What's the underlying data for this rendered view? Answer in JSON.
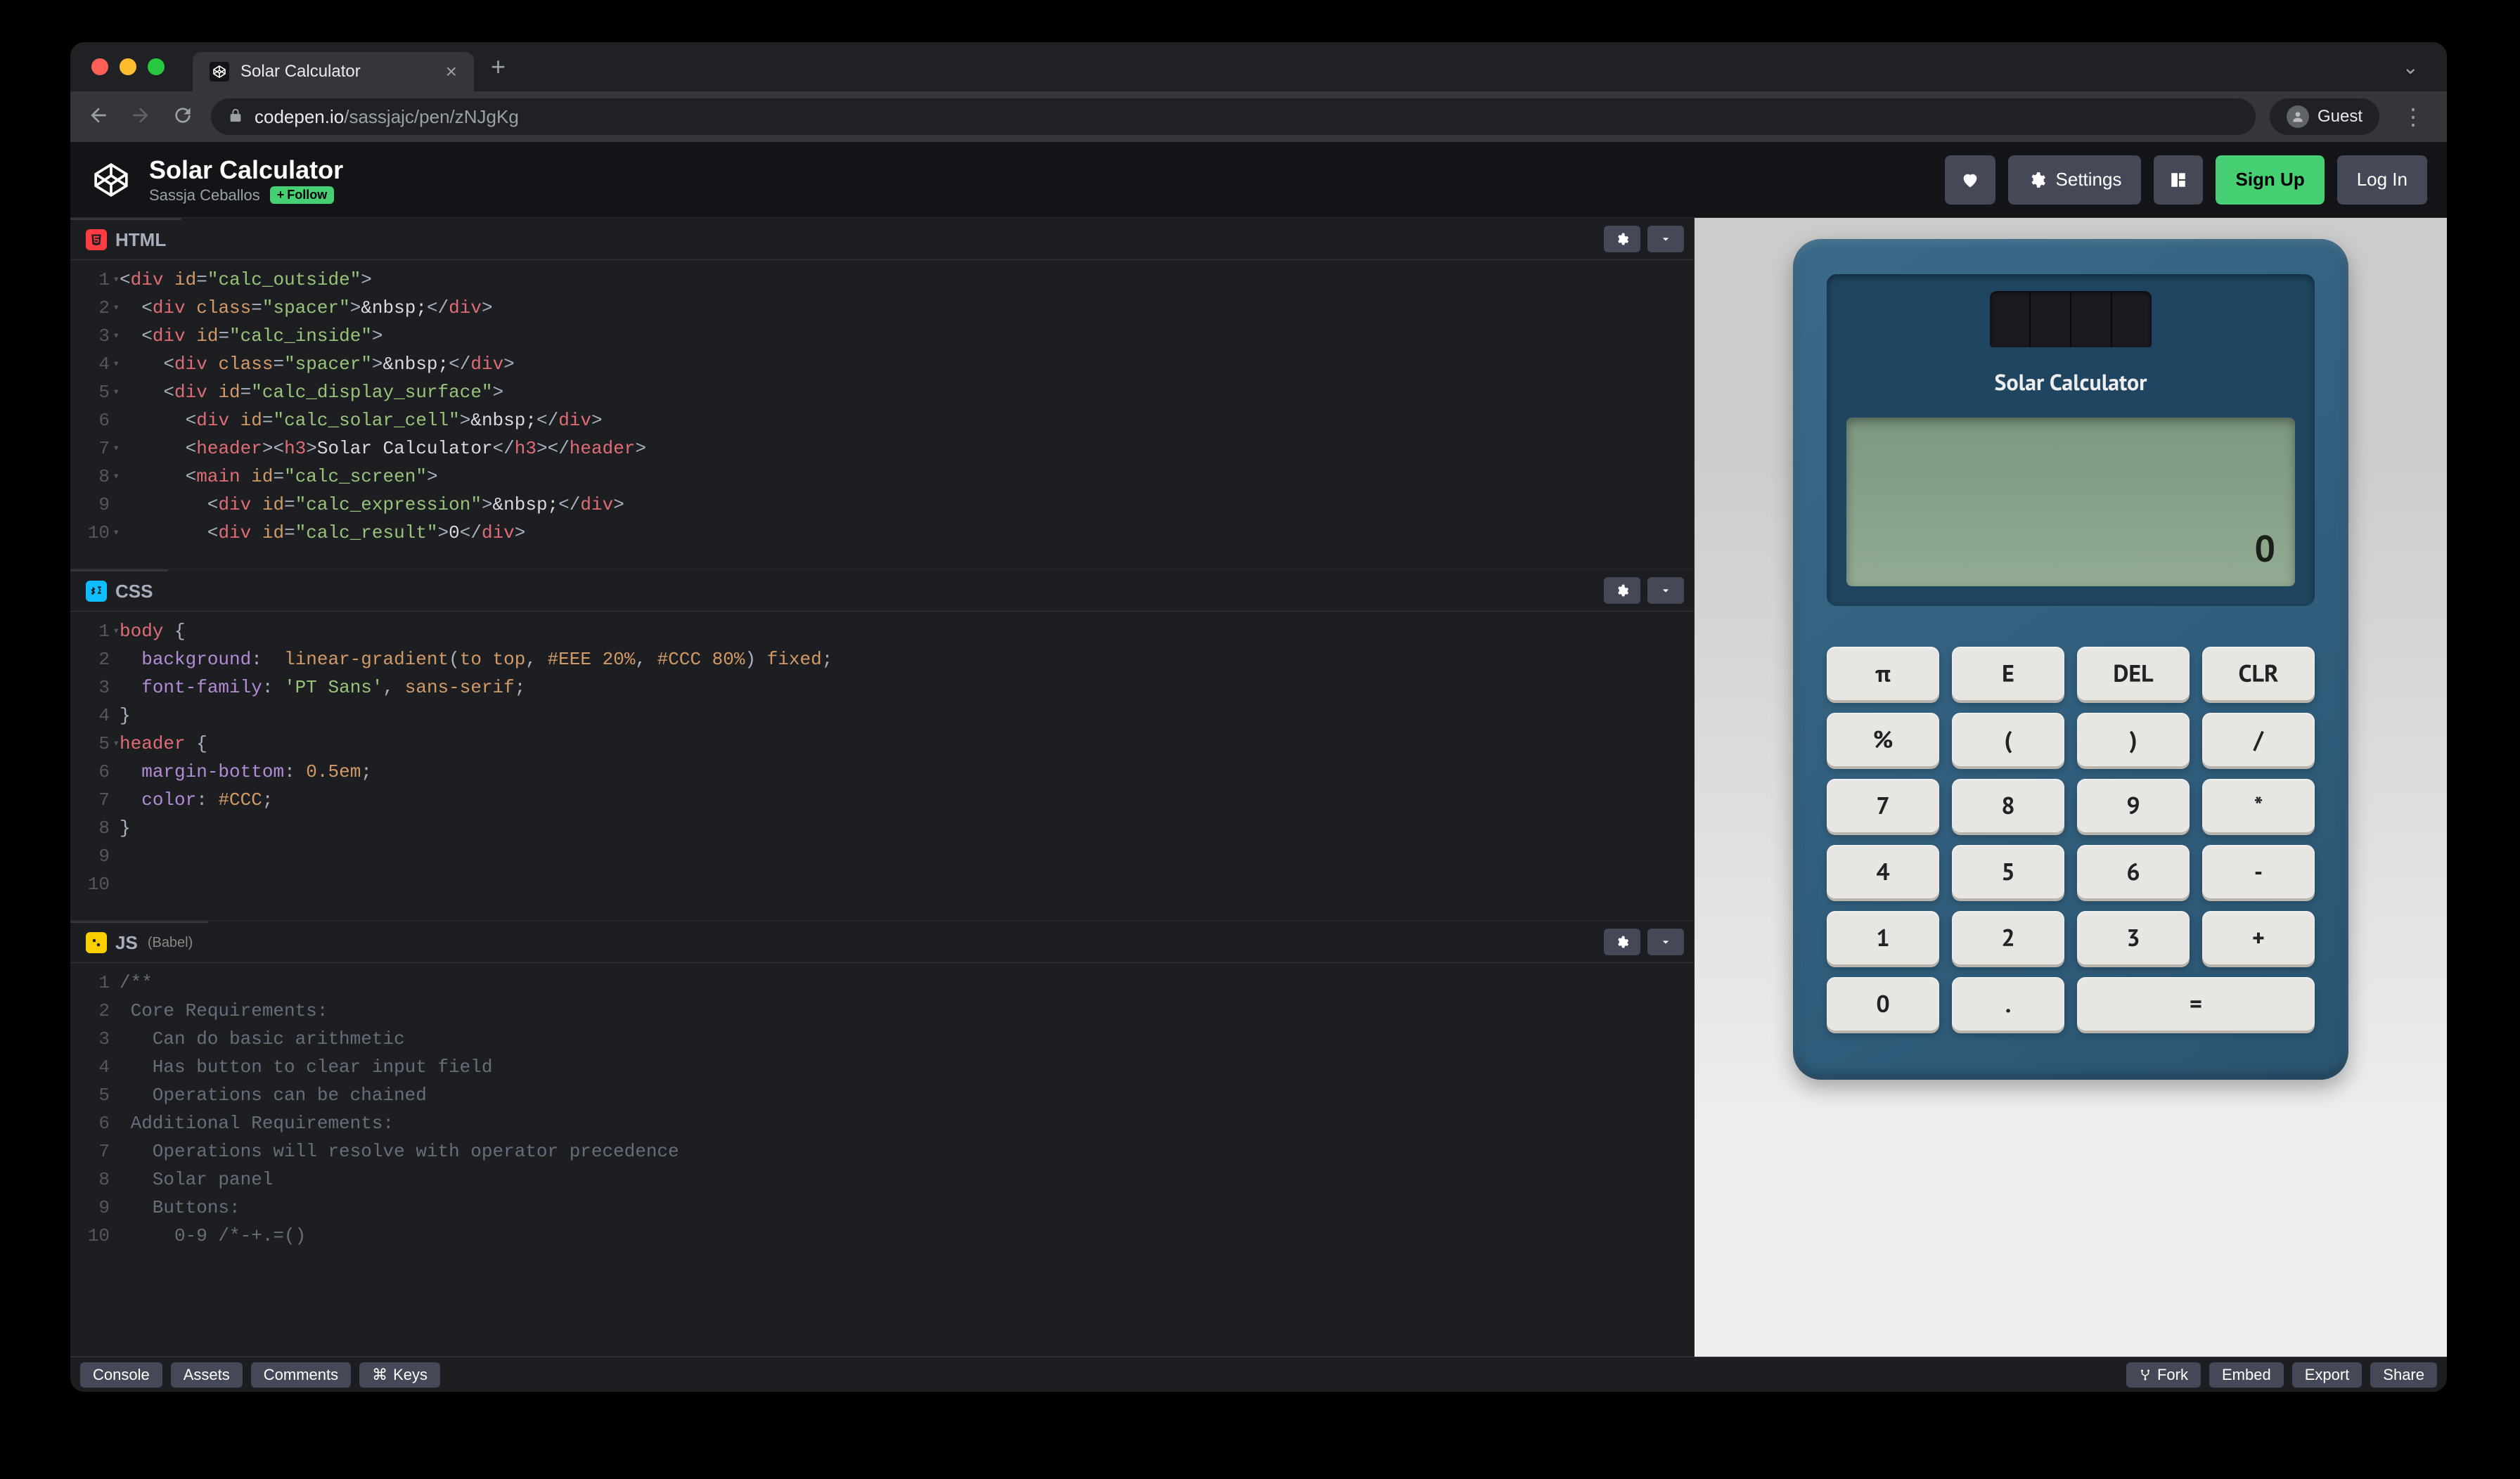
{
  "browser": {
    "tab_title": "Solar Calculator",
    "url_host": "codepen.io",
    "url_path": "/sassjajc/pen/zNJgKg",
    "guest_label": "Guest"
  },
  "codepen": {
    "pen_title": "Solar Calculator",
    "author": "Sassja Ceballos",
    "follow_label": "Follow",
    "settings_label": "Settings",
    "signup_label": "Sign Up",
    "login_label": "Log In"
  },
  "panels": {
    "html_label": "HTML",
    "css_label": "CSS",
    "js_label": "JS",
    "js_subtitle": "(Babel)"
  },
  "html_code": [
    {
      "n": "1",
      "fold": true,
      "content": [
        [
          "punc",
          "<"
        ],
        [
          "tag",
          "div"
        ],
        [
          "text",
          " "
        ],
        [
          "attr",
          "id"
        ],
        [
          "punc",
          "="
        ],
        [
          "str",
          "\"calc_outside\""
        ],
        [
          "punc",
          ">"
        ]
      ]
    },
    {
      "n": "2",
      "fold": true,
      "content": [
        [
          "text",
          "  "
        ],
        [
          "punc",
          "<"
        ],
        [
          "tag",
          "div"
        ],
        [
          "text",
          " "
        ],
        [
          "attr",
          "class"
        ],
        [
          "punc",
          "="
        ],
        [
          "str",
          "\"spacer\""
        ],
        [
          "punc",
          ">"
        ],
        [
          "text",
          "&nbsp;"
        ],
        [
          "punc",
          "</"
        ],
        [
          "tag",
          "div"
        ],
        [
          "punc",
          ">"
        ]
      ]
    },
    {
      "n": "3",
      "fold": true,
      "content": [
        [
          "text",
          "  "
        ],
        [
          "punc",
          "<"
        ],
        [
          "tag",
          "div"
        ],
        [
          "text",
          " "
        ],
        [
          "attr",
          "id"
        ],
        [
          "punc",
          "="
        ],
        [
          "str",
          "\"calc_inside\""
        ],
        [
          "punc",
          ">"
        ]
      ]
    },
    {
      "n": "4",
      "fold": true,
      "content": [
        [
          "text",
          "    "
        ],
        [
          "punc",
          "<"
        ],
        [
          "tag",
          "div"
        ],
        [
          "text",
          " "
        ],
        [
          "attr",
          "class"
        ],
        [
          "punc",
          "="
        ],
        [
          "str",
          "\"spacer\""
        ],
        [
          "punc",
          ">"
        ],
        [
          "text",
          "&nbsp;"
        ],
        [
          "punc",
          "</"
        ],
        [
          "tag",
          "div"
        ],
        [
          "punc",
          ">"
        ]
      ]
    },
    {
      "n": "5",
      "fold": true,
      "content": [
        [
          "text",
          "    "
        ],
        [
          "punc",
          "<"
        ],
        [
          "tag",
          "div"
        ],
        [
          "text",
          " "
        ],
        [
          "attr",
          "id"
        ],
        [
          "punc",
          "="
        ],
        [
          "str",
          "\"calc_display_surface\""
        ],
        [
          "punc",
          ">"
        ]
      ]
    },
    {
      "n": "6",
      "fold": false,
      "content": [
        [
          "text",
          "      "
        ],
        [
          "punc",
          "<"
        ],
        [
          "tag",
          "div"
        ],
        [
          "text",
          " "
        ],
        [
          "attr",
          "id"
        ],
        [
          "punc",
          "="
        ],
        [
          "str",
          "\"calc_solar_cell\""
        ],
        [
          "punc",
          ">"
        ],
        [
          "text",
          "&nbsp;"
        ],
        [
          "punc",
          "</"
        ],
        [
          "tag",
          "div"
        ],
        [
          "punc",
          ">"
        ]
      ]
    },
    {
      "n": "7",
      "fold": true,
      "content": [
        [
          "text",
          "      "
        ],
        [
          "punc",
          "<"
        ],
        [
          "tag",
          "header"
        ],
        [
          "punc",
          "><"
        ],
        [
          "tag",
          "h3"
        ],
        [
          "punc",
          ">"
        ],
        [
          "text",
          "Solar Calculator"
        ],
        [
          "punc",
          "</"
        ],
        [
          "tag",
          "h3"
        ],
        [
          "punc",
          "></"
        ],
        [
          "tag",
          "header"
        ],
        [
          "punc",
          ">"
        ]
      ]
    },
    {
      "n": "8",
      "fold": true,
      "content": [
        [
          "text",
          "      "
        ],
        [
          "punc",
          "<"
        ],
        [
          "tag",
          "main"
        ],
        [
          "text",
          " "
        ],
        [
          "attr",
          "id"
        ],
        [
          "punc",
          "="
        ],
        [
          "str",
          "\"calc_screen\""
        ],
        [
          "punc",
          ">"
        ]
      ]
    },
    {
      "n": "9",
      "fold": false,
      "content": [
        [
          "text",
          "        "
        ],
        [
          "punc",
          "<"
        ],
        [
          "tag",
          "div"
        ],
        [
          "text",
          " "
        ],
        [
          "attr",
          "id"
        ],
        [
          "punc",
          "="
        ],
        [
          "str",
          "\"calc_expression\""
        ],
        [
          "punc",
          ">"
        ],
        [
          "text",
          "&nbsp;"
        ],
        [
          "punc",
          "</"
        ],
        [
          "tag",
          "div"
        ],
        [
          "punc",
          ">"
        ]
      ]
    },
    {
      "n": "10",
      "fold": true,
      "content": [
        [
          "text",
          "        "
        ],
        [
          "punc",
          "<"
        ],
        [
          "tag",
          "div"
        ],
        [
          "text",
          " "
        ],
        [
          "attr",
          "id"
        ],
        [
          "punc",
          "="
        ],
        [
          "str",
          "\"calc_result\""
        ],
        [
          "punc",
          ">"
        ],
        [
          "text",
          "0"
        ],
        [
          "punc",
          "</"
        ],
        [
          "tag",
          "div"
        ],
        [
          "punc",
          ">"
        ]
      ]
    }
  ],
  "css_code": [
    {
      "n": "1",
      "fold": true,
      "content": [
        [
          "sel",
          "body"
        ],
        [
          "text",
          " "
        ],
        [
          "punc",
          "{"
        ]
      ]
    },
    {
      "n": "2",
      "content": [
        [
          "text",
          "  "
        ],
        [
          "prop",
          "background"
        ],
        [
          "punc",
          ":  "
        ],
        [
          "val",
          "linear-gradient"
        ],
        [
          "punc",
          "("
        ],
        [
          "val",
          "to"
        ],
        [
          "text",
          " "
        ],
        [
          "val",
          "top"
        ],
        [
          "punc",
          ", "
        ],
        [
          "id",
          "#EEE"
        ],
        [
          "text",
          " "
        ],
        [
          "num",
          "20%"
        ],
        [
          "punc",
          ", "
        ],
        [
          "id",
          "#CCC"
        ],
        [
          "text",
          " "
        ],
        [
          "num",
          "80%"
        ],
        [
          "punc",
          ") "
        ],
        [
          "val",
          "fixed"
        ],
        [
          "punc",
          ";"
        ]
      ]
    },
    {
      "n": "3",
      "content": [
        [
          "text",
          "  "
        ],
        [
          "prop",
          "font-family"
        ],
        [
          "punc",
          ": "
        ],
        [
          "str",
          "'PT Sans'"
        ],
        [
          "punc",
          ", "
        ],
        [
          "val",
          "sans-serif"
        ],
        [
          "punc",
          ";"
        ]
      ]
    },
    {
      "n": "4",
      "content": [
        [
          "punc",
          "}"
        ]
      ]
    },
    {
      "n": "5",
      "fold": true,
      "content": [
        [
          "sel",
          "header"
        ],
        [
          "text",
          " "
        ],
        [
          "punc",
          "{"
        ]
      ]
    },
    {
      "n": "6",
      "content": [
        [
          "text",
          "  "
        ],
        [
          "prop",
          "margin-bottom"
        ],
        [
          "punc",
          ": "
        ],
        [
          "num",
          "0.5em"
        ],
        [
          "punc",
          ";"
        ]
      ]
    },
    {
      "n": "7",
      "content": [
        [
          "text",
          "  "
        ],
        [
          "prop",
          "color"
        ],
        [
          "punc",
          ": "
        ],
        [
          "id",
          "#CCC"
        ],
        [
          "punc",
          ";"
        ]
      ]
    },
    {
      "n": "8",
      "content": [
        [
          "punc",
          "}"
        ]
      ]
    },
    {
      "n": "9",
      "content": []
    },
    {
      "n": "10",
      "content": []
    }
  ],
  "js_code": [
    {
      "n": "1",
      "content": [
        [
          "comm",
          "/**"
        ]
      ]
    },
    {
      "n": "2",
      "content": [
        [
          "comm",
          " Core Requirements:"
        ]
      ]
    },
    {
      "n": "3",
      "content": [
        [
          "comm",
          "   Can do basic arithmetic"
        ]
      ]
    },
    {
      "n": "4",
      "content": [
        [
          "comm",
          "   Has button to clear input field"
        ]
      ]
    },
    {
      "n": "5",
      "content": [
        [
          "comm",
          "   Operations can be chained"
        ]
      ]
    },
    {
      "n": "6",
      "content": [
        [
          "comm",
          " Additional Requirements:"
        ]
      ]
    },
    {
      "n": "7",
      "content": [
        [
          "comm",
          "   Operations will resolve with operator precedence"
        ]
      ]
    },
    {
      "n": "8",
      "content": [
        [
          "comm",
          "   Solar panel"
        ]
      ]
    },
    {
      "n": "9",
      "content": [
        [
          "comm",
          "   Buttons:"
        ]
      ]
    },
    {
      "n": "10",
      "content": [
        [
          "comm",
          "     0-9 /*-+.=()"
        ]
      ]
    }
  ],
  "calculator": {
    "title": "Solar Calculator",
    "expression": "",
    "result": "0",
    "buttons": [
      {
        "label": "π",
        "span": 1
      },
      {
        "label": "E",
        "span": 1
      },
      {
        "label": "DEL",
        "span": 1
      },
      {
        "label": "CLR",
        "span": 1
      },
      {
        "label": "%",
        "span": 1
      },
      {
        "label": "(",
        "span": 1
      },
      {
        "label": ")",
        "span": 1
      },
      {
        "label": "/",
        "span": 1
      },
      {
        "label": "7",
        "span": 1
      },
      {
        "label": "8",
        "span": 1
      },
      {
        "label": "9",
        "span": 1
      },
      {
        "label": "*",
        "span": 1
      },
      {
        "label": "4",
        "span": 1
      },
      {
        "label": "5",
        "span": 1
      },
      {
        "label": "6",
        "span": 1
      },
      {
        "label": "-",
        "span": 1
      },
      {
        "label": "1",
        "span": 1
      },
      {
        "label": "2",
        "span": 1
      },
      {
        "label": "3",
        "span": 1
      },
      {
        "label": "+",
        "span": 1
      },
      {
        "label": "0",
        "span": 1
      },
      {
        "label": ".",
        "span": 1
      },
      {
        "label": "=",
        "span": 2
      }
    ]
  },
  "footer": {
    "console": "Console",
    "assets": "Assets",
    "comments": "Comments",
    "keys": "Keys",
    "keys_prefix": "⌘",
    "fork": "Fork",
    "embed": "Embed",
    "export": "Export",
    "share": "Share"
  }
}
